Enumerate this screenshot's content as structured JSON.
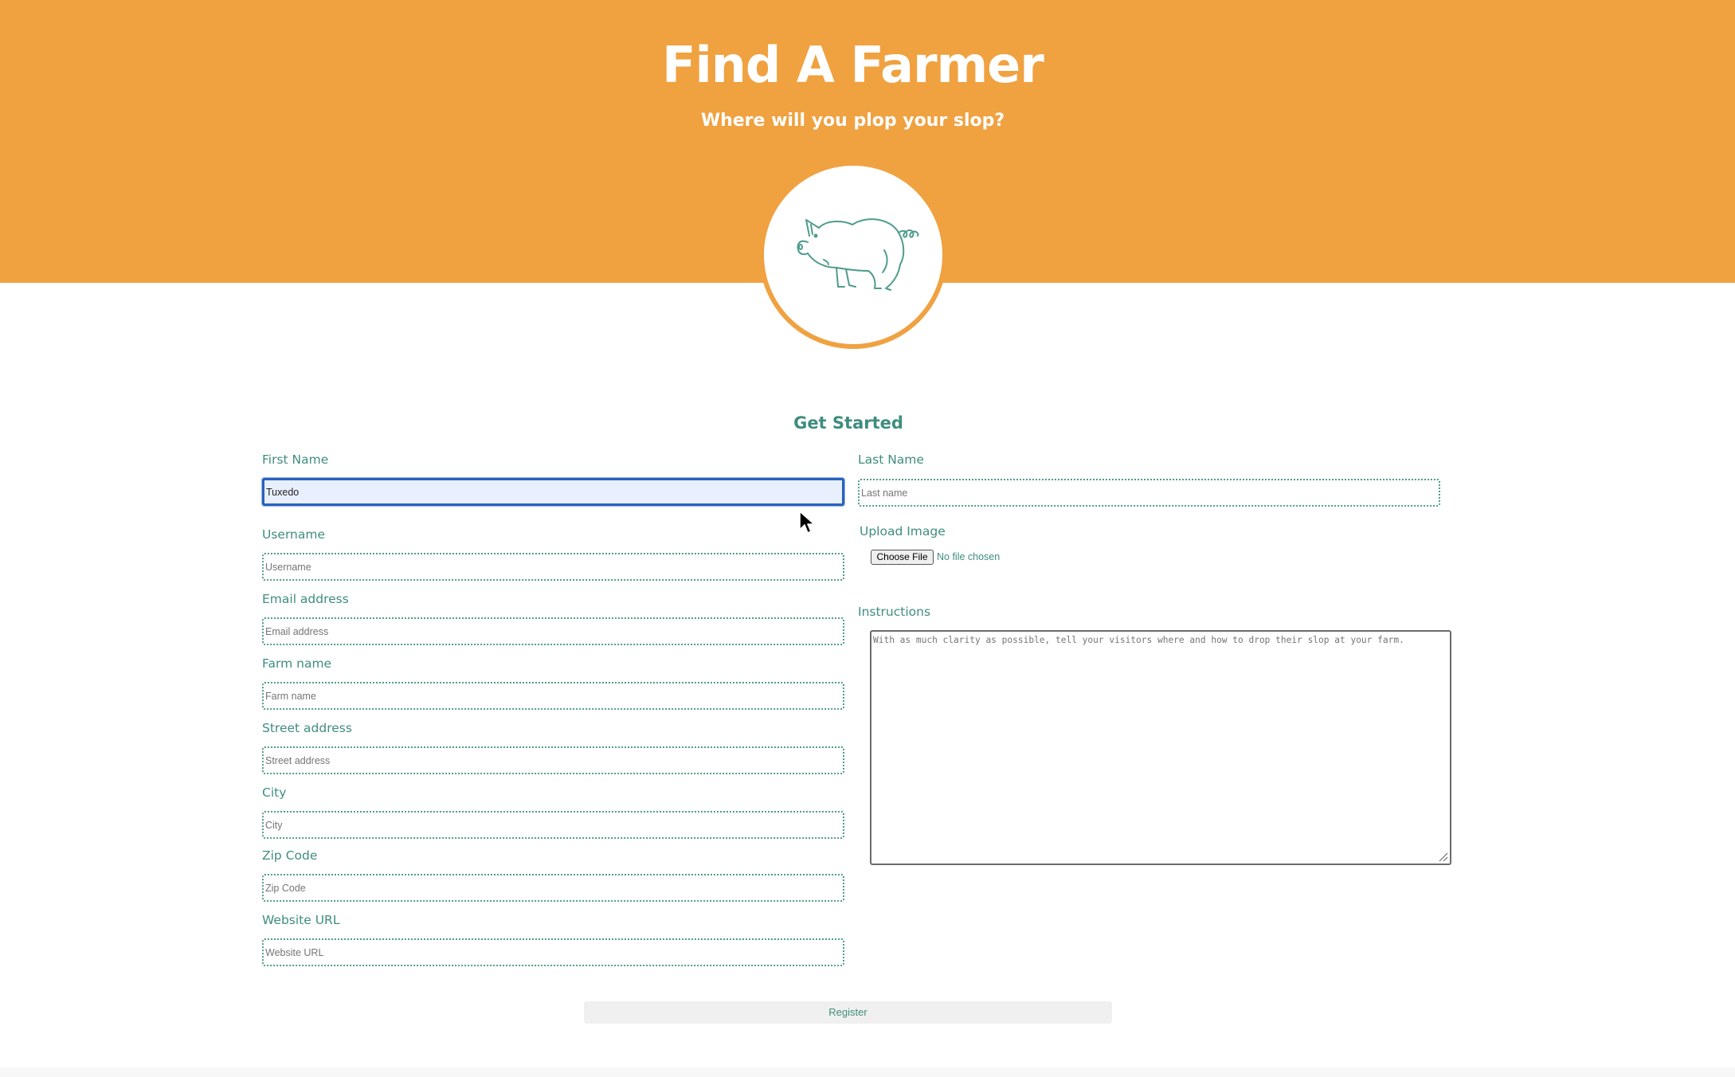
{
  "header": {
    "title": "Find A Farmer",
    "subtitle": "Where will you plop your slop?",
    "logo": "pig-icon",
    "background_color": "#f0a140"
  },
  "form": {
    "heading": "Get Started",
    "fields": {
      "first_name": {
        "label": "First Name",
        "value": "Tuxedo",
        "placeholder": "First name",
        "focused": true
      },
      "last_name": {
        "label": "Last Name",
        "value": "",
        "placeholder": "Last name"
      },
      "username": {
        "label": "Username",
        "value": "",
        "placeholder": "Username"
      },
      "email": {
        "label": "Email address",
        "value": "",
        "placeholder": "Email address"
      },
      "farm_name": {
        "label": "Farm name",
        "value": "",
        "placeholder": "Farm name"
      },
      "street_address": {
        "label": "Street address",
        "value": "",
        "placeholder": "Street address"
      },
      "city": {
        "label": "City",
        "value": "",
        "placeholder": "City"
      },
      "zip_code": {
        "label": "Zip Code",
        "value": "",
        "placeholder": "Zip Code"
      },
      "website_url": {
        "label": "Website URL",
        "value": "",
        "placeholder": "Website URL"
      }
    },
    "upload": {
      "label": "Upload Image",
      "button_label": "Choose File",
      "status": "No file chosen"
    },
    "instructions": {
      "label": "Instructions",
      "placeholder": "With as much clarity as possible, tell your visitors where and how to drop their slop at your farm."
    },
    "submit_label": "Register"
  },
  "colors": {
    "accent": "#f0a140",
    "label_teal": "#3f8d7f",
    "focus_blue": "#2a62bd"
  }
}
